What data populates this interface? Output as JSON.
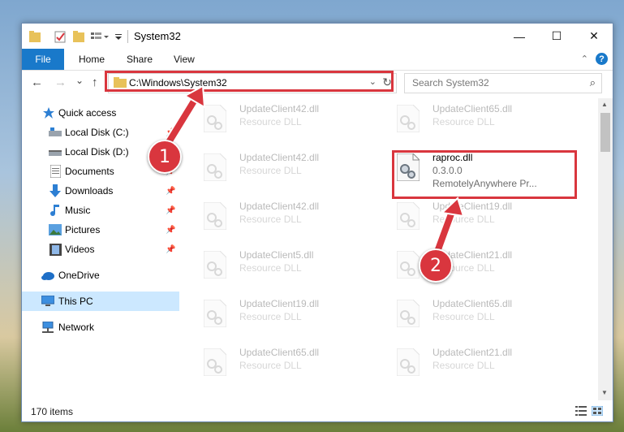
{
  "window": {
    "title": "System32",
    "minimize": "—",
    "maximize": "☐",
    "close": "✕"
  },
  "ribbon": {
    "file": "File",
    "home": "Home",
    "share": "Share",
    "view": "View",
    "help": "?"
  },
  "navbar": {
    "back": "←",
    "forward": "→",
    "recent": "⌄",
    "up": "↑",
    "address": "C:\\Windows\\System32",
    "search_placeholder": "Search System32"
  },
  "sidebar": {
    "items": [
      {
        "label": "Quick access",
        "icon": "star-icon"
      },
      {
        "label": "Local Disk (C:)",
        "icon": "drive-icon"
      },
      {
        "label": "Local Disk (D:)",
        "icon": "drive-icon"
      },
      {
        "label": "Documents",
        "icon": "documents-icon"
      },
      {
        "label": "Downloads",
        "icon": "download-icon"
      },
      {
        "label": "Music",
        "icon": "music-icon"
      },
      {
        "label": "Pictures",
        "icon": "pictures-icon"
      },
      {
        "label": "Videos",
        "icon": "videos-icon"
      },
      {
        "label": "OneDrive",
        "icon": "cloud-icon"
      },
      {
        "label": "This PC",
        "icon": "computer-icon"
      },
      {
        "label": "Network",
        "icon": "network-icon"
      }
    ]
  },
  "files": {
    "left": [
      {
        "name": "UpdateClient42.dll",
        "type": "Resource DLL"
      },
      {
        "name": "UpdateClient42.dll",
        "type": "Resource DLL"
      },
      {
        "name": "UpdateClient42.dll",
        "type": "Resource DLL"
      },
      {
        "name": "UpdateClient5.dll",
        "type": "Resource DLL"
      },
      {
        "name": "UpdateClient19.dll",
        "type": "Resource DLL"
      },
      {
        "name": "UpdateClient65.dll",
        "type": "Resource DLL"
      }
    ],
    "right": [
      {
        "name": "UpdateClient65.dll",
        "type": "Resource DLL"
      },
      {
        "name": "UpdateClient19.dll",
        "type": "Resource DLL"
      },
      {
        "name": "UpdateClient21.dll",
        "type": "Resource DLL"
      },
      {
        "name": "UpdateClient65.dll",
        "type": "Resource DLL"
      },
      {
        "name": "UpdateClient21.dll",
        "type": "Resource DLL"
      }
    ],
    "featured": {
      "name": "raproc.dll",
      "version": "0.3.0.0",
      "company": "RemotelyAnywhere Pr..."
    }
  },
  "status": {
    "count": "170 items"
  },
  "callouts": {
    "one": "1",
    "two": "2"
  },
  "colors": {
    "accent": "#1979ca",
    "highlight": "#d9363e",
    "selected": "#cce8ff"
  }
}
